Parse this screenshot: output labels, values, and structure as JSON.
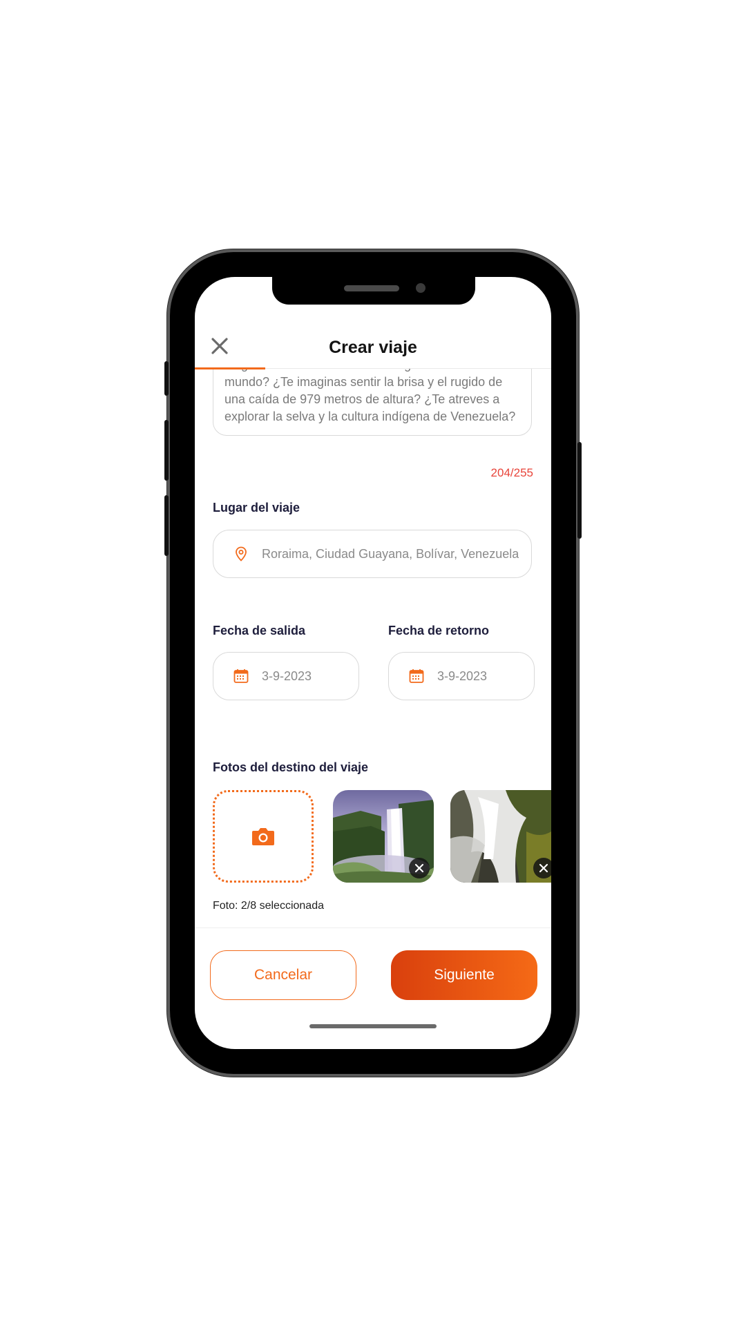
{
  "header": {
    "title": "Crear viaje",
    "close_icon": "close-icon"
  },
  "description": {
    "text": "Te gustaría conocer el salto de agua más alto del mundo? ¿Te imaginas sentir la brisa y el rugido de una caída de 979 metros de altura? ¿Te atreves a explorar la selva y la cultura indígena de Venezuela?",
    "counter": "204/255"
  },
  "location": {
    "label": "Lugar del viaje",
    "value": "Roraima, Ciudad Guayana, Bolívar, Venezuela",
    "icon": "location-pin-icon"
  },
  "dates": {
    "departure_label": "Fecha de salida",
    "departure_value": "3-9-2023",
    "return_label": "Fecha de retorno",
    "return_value": "3-9-2023",
    "icon": "calendar-icon"
  },
  "photos": {
    "label": "Fotos del destino del viaje",
    "add_icon": "camera-icon",
    "count_text": "Foto: 2/8 seleccionada"
  },
  "footer": {
    "cancel_label": "Cancelar",
    "next_label": "Siguiente"
  },
  "colors": {
    "accent": "#f26a1b",
    "accent_dark": "#d9400d",
    "counter": "#e8443a",
    "label": "#1e1e3c"
  }
}
